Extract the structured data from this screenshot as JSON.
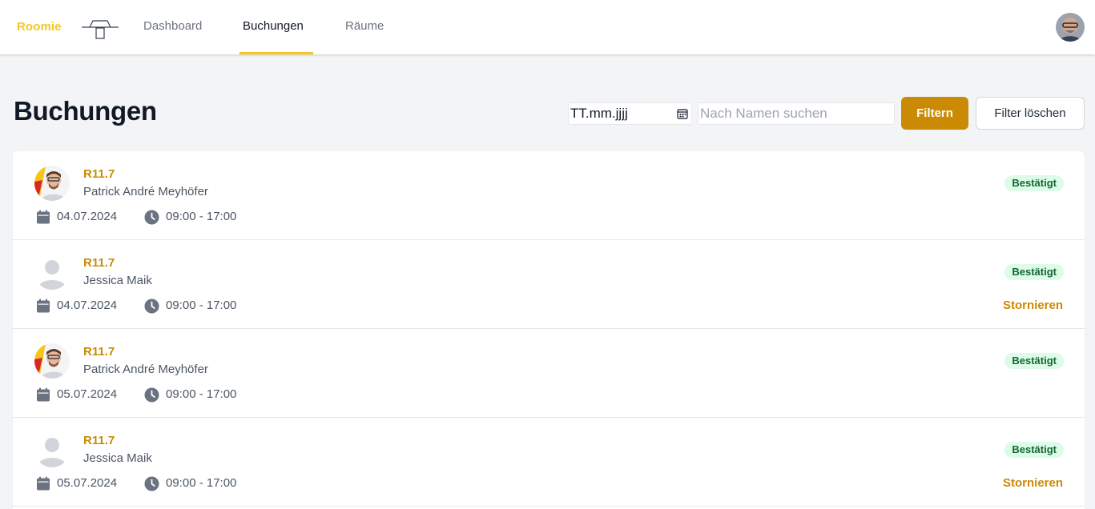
{
  "header": {
    "brand": "Roomie",
    "nav": [
      {
        "label": "Dashboard",
        "active": false
      },
      {
        "label": "Buchungen",
        "active": true
      },
      {
        "label": "Räume",
        "active": false
      }
    ],
    "accent_color": "#f3c623"
  },
  "page": {
    "title": "Buchungen"
  },
  "filters": {
    "date_placeholder": "TT.mm.jjjj",
    "search_placeholder": "Nach Namen suchen",
    "filter_button": "Filtern",
    "clear_button": "Filter löschen"
  },
  "bookings": [
    {
      "room": "R11.7",
      "person": "Patrick André Meyhöfer",
      "date": "04.07.2024",
      "time": "09:00 - 17:00",
      "status": "Bestätigt",
      "avatar": "photo",
      "action": ""
    },
    {
      "room": "R11.7",
      "person": "Jessica Maik",
      "date": "04.07.2024",
      "time": "09:00 - 17:00",
      "status": "Bestätigt",
      "avatar": "placeholder",
      "action": "Stornieren"
    },
    {
      "room": "R11.7",
      "person": "Patrick André Meyhöfer",
      "date": "05.07.2024",
      "time": "09:00 - 17:00",
      "status": "Bestätigt",
      "avatar": "photo",
      "action": ""
    },
    {
      "room": "R11.7",
      "person": "Jessica Maik",
      "date": "05.07.2024",
      "time": "09:00 - 17:00",
      "status": "Bestätigt",
      "avatar": "placeholder",
      "action": "Stornieren"
    }
  ],
  "colors": {
    "primary": "#ca8a04",
    "status_bg": "#dcfce7",
    "status_text": "#166534"
  }
}
